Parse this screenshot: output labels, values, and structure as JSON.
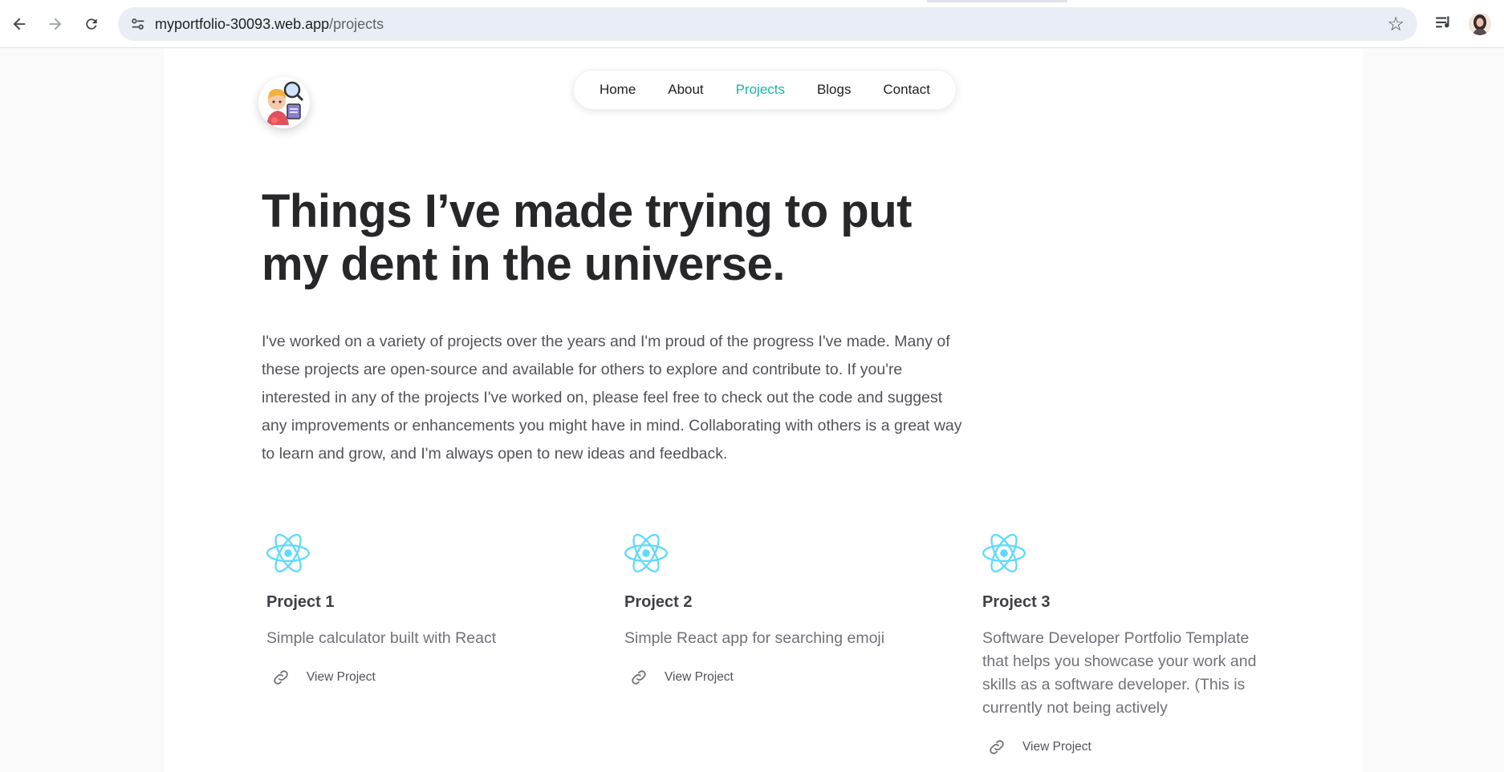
{
  "browser": {
    "url_host": "myportfolio-30093.web.app",
    "url_path": "/projects"
  },
  "nav": {
    "items": [
      {
        "label": "Home"
      },
      {
        "label": "About"
      },
      {
        "label": "Projects",
        "active": true
      },
      {
        "label": "Blogs"
      },
      {
        "label": "Contact"
      }
    ],
    "active_color": "#14b8a6"
  },
  "hero": {
    "headline": "Things I’ve made trying to put my dent in the universe.",
    "intro": "I've worked on a variety of projects over the years and I'm proud of the progress I've made. Many of these projects are open-source and available for others to explore and contribute to. If you're interested in any of the projects I've worked on, please feel free to check out the code and suggest any improvements or enhancements you might have in mind. Collaborating with others is a great way to learn and grow, and I'm always open to new ideas and feedback."
  },
  "projects": [
    {
      "icon": "react-icon",
      "title": "Project 1",
      "description": "Simple calculator built with React",
      "link_label": "View Project"
    },
    {
      "icon": "react-icon",
      "title": "Project 2",
      "description": "Simple React app for searching emoji",
      "link_label": "View Project"
    },
    {
      "icon": "react-icon",
      "title": "Project 3",
      "description": "Software Developer Portfolio Template that helps you showcase your work and skills as a software developer. (This is currently not being actively",
      "link_label": "View Project"
    }
  ],
  "colors": {
    "react": "#61dafb",
    "headline": "#27272a",
    "body_text": "#52525b"
  }
}
